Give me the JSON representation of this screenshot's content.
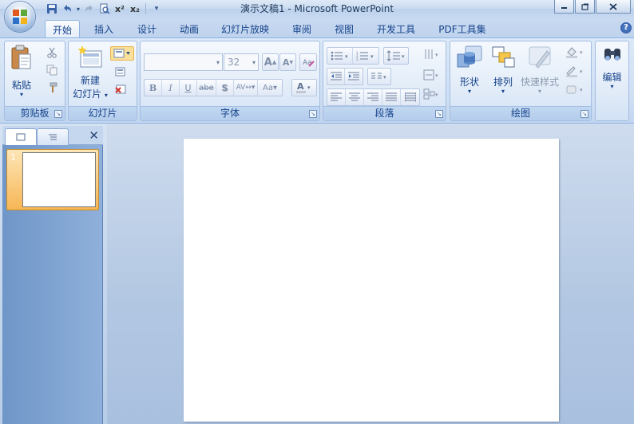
{
  "window": {
    "title": "演示文稿1 - Microsoft PowerPoint",
    "controls": [
      "minimize",
      "restore",
      "close"
    ]
  },
  "quick_access": [
    "save-icon",
    "undo-icon",
    "redo-icon",
    "print-preview-icon",
    "superscript-icon",
    "subscript-icon",
    "customize-icon"
  ],
  "tabs": [
    "开始",
    "插入",
    "设计",
    "动画",
    "幻灯片放映",
    "审阅",
    "视图",
    "开发工具",
    "PDF工具集"
  ],
  "active_tab": "开始",
  "ribbon": {
    "clipboard": {
      "label": "剪贴板",
      "paste": "粘贴"
    },
    "slides": {
      "label": "幻灯片",
      "new_slide": "新建",
      "new_slide_line2": "幻灯片"
    },
    "font": {
      "label": "字体",
      "font_name": "",
      "font_size": "32"
    },
    "paragraph": {
      "label": "段落"
    },
    "drawing": {
      "label": "绘图",
      "shapes": "形状",
      "arrange": "排列",
      "quick_styles": "快速样式"
    },
    "editing": {
      "label": "编辑"
    }
  },
  "slides_pane": {
    "thumbnails": [
      {
        "number": "1"
      }
    ]
  },
  "colors": {
    "ribbon_bg": "#dbe8f7",
    "accent": "#15428b",
    "selected_thumb": "#f7b655"
  }
}
